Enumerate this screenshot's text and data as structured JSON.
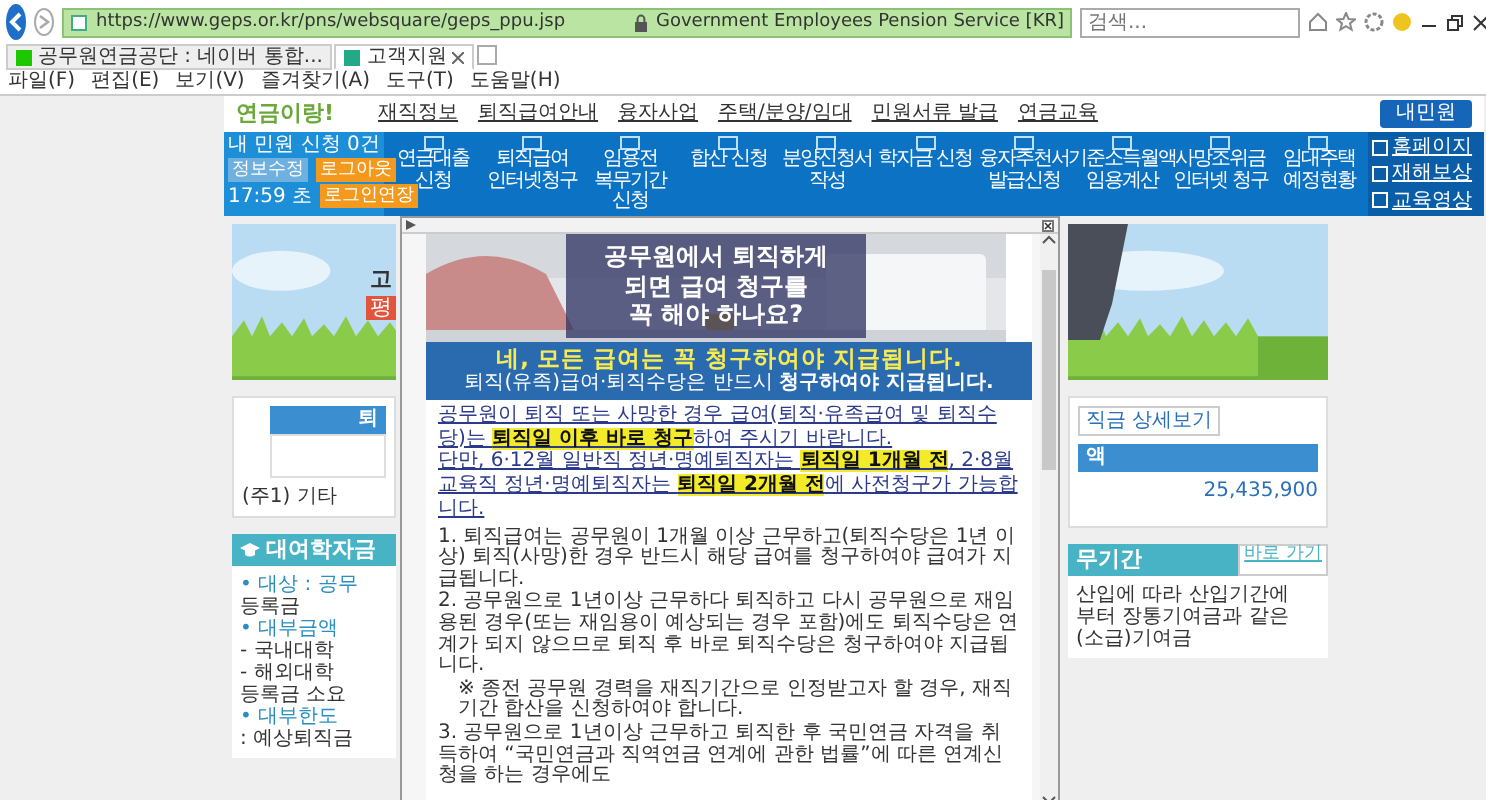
{
  "browser": {
    "url": "https://www.geps.or.kr/pns/websquare/geps_ppu.jsp",
    "site_identity": "Government Employees Pension Service [KR]",
    "search": {
      "placeholder": "검색..."
    },
    "tabs": [
      {
        "label": "공무원연금공단 : 네이버 통합...",
        "selected": false
      },
      {
        "label": "고객지원",
        "selected": true
      }
    ],
    "menu": [
      "파일(F)",
      "편집(E)",
      "보기(V)",
      "즐겨찾기(A)",
      "도구(T)",
      "도움말(H)"
    ]
  },
  "header": {
    "logo": "연금이랑!",
    "nav": [
      "재직정보",
      "퇴직급여안내",
      "융자사업",
      "주택/분양/임대",
      "민원서류 발급",
      "연금교육"
    ],
    "action": "내민원"
  },
  "quickbar": {
    "requests": "내 민원 신청 0건",
    "buttons": [
      {
        "label": "정보수정",
        "kind": "plain"
      },
      {
        "label": "로그아웃",
        "kind": "accent"
      }
    ],
    "timer": "17:59 초",
    "extend": "로그인연장",
    "items": [
      "연금대출 신청",
      "퇴직급여 인터넷청구",
      "임용전 복무기간 신청",
      "합산 신청",
      "분양신청서 작성",
      "학자금 신청",
      "융자추천서 발급신청",
      "기준소득월액 임용계산",
      "사망조위금 인터넷 청구",
      "임대주택 예정현황"
    ],
    "links": [
      "홈페이지",
      "재해보상",
      "교육영상"
    ]
  },
  "left": {
    "banner": [
      "고",
      "평"
    ],
    "table_header": "퇴",
    "note": "(주1) 기타",
    "loan": {
      "title": "대여학자금",
      "lines": [
        {
          "text": "• 대상 : 공무",
          "kind": "head"
        },
        {
          "text": "등록금",
          "kind": "text"
        },
        {
          "text": "• 대부금액",
          "kind": "head"
        },
        {
          "text": "- 국내대학",
          "kind": "text"
        },
        {
          "text": "- 해외대학",
          "kind": "text"
        },
        {
          "text": "등록금 소요",
          "kind": "text"
        },
        {
          "text": "• 대부한도",
          "kind": "head"
        },
        {
          "text": ": 예상퇴직금",
          "kind": "text"
        }
      ]
    }
  },
  "right": {
    "detail_button": "직금 상세보기",
    "table_header": "액",
    "amount": "25,435,900",
    "section": "무기간",
    "section_link": "바로 가기",
    "lines": [
      "산입에 따라 산입기간에",
      "부터 장통기여금과 같은",
      "(소급)기여금"
    ]
  },
  "popup": {
    "picture_title": [
      "공무원에서 퇴직하게",
      "되면 급여 청구를",
      "꼭 해야 하나요?"
    ],
    "banner_title": "네, 모든 급여는 꼭 청구하여야 지급됩니다.",
    "banner_subtitle": "퇴직(유족)급여·퇴직수당은 반드시 **청구하여야 지급됩니다.**",
    "notice": [
      "공무원이 퇴직 또는 사망한 경우 급여(퇴직·유족급여 및 퇴직수당)는 **퇴직일 이후 바로 청구**하여 주시기 바랍니다.",
      "단만, 6·12월 일반직 정년·명예퇴직자는 **퇴직일 1개월 전**, 2·8월 교육직 정년·명예퇴직자는 **퇴직일 2개월 전**에 사전청구가 가능합니다."
    ],
    "items": [
      {
        "text": "1. 퇴직급여는 공무원이 1개월 이상 근무하고(퇴직수당은 1년 이상) 퇴직(사망)한 경우 반드시 해당 급여를 청구하여야 급여가 지급됩니다.",
        "kind": "item"
      },
      {
        "text": "2. 공무원으로 1년이상 근무하다 퇴직하고 다시 공무원으로 재임용된 경우(또는 재임용이 예상되는 경우 포함)에도 퇴직수당은 연계가 되지 않으므로 퇴직 후 바로 퇴직수당은 청구하여야 지급됩니다.",
        "kind": "item"
      },
      {
        "text": "※ 종전 공무원 경력을 재직기간으로 인정받고자 할 경우, 재직기간 합산을 신청하여야 합니다.",
        "kind": "note"
      },
      {
        "text": "3. 공무원으로 1년이상 근무하고 퇴직한 후 국민연금 자격을 취득하여 “국민연금과 직역연금 연계에 관한 법률”에 따른 연계신청을 하는 경우에도",
        "kind": "item"
      }
    ]
  }
}
